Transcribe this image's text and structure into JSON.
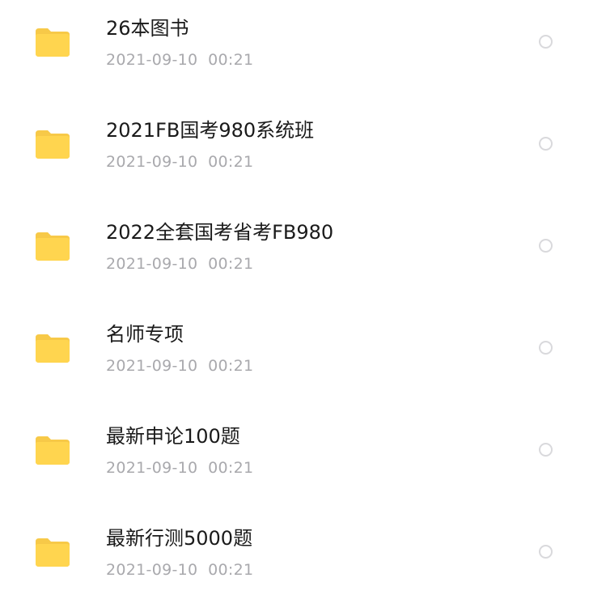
{
  "files": [
    {
      "name": "26本图书",
      "date": "2021-09-10  00:21",
      "icon": "folder-icon"
    },
    {
      "name": "2021FB国考980系统班",
      "date": "2021-09-10  00:21",
      "icon": "folder-icon"
    },
    {
      "name": "2022全套国考省考FB980",
      "date": "2021-09-10  00:21",
      "icon": "folder-icon"
    },
    {
      "name": "名师专项",
      "date": "2021-09-10  00:21",
      "icon": "folder-icon"
    },
    {
      "name": "最新申论100题",
      "date": "2021-09-10  00:21",
      "icon": "folder-icon"
    },
    {
      "name": "最新行测5000题",
      "date": "2021-09-10  00:21",
      "icon": "folder-icon"
    }
  ],
  "colors": {
    "folder": "#FFD54F",
    "folder_tab": "#F7C948",
    "name_text": "#1a1a1a",
    "date_text": "#a9a9ad",
    "radio_border": "#d9d9dc"
  }
}
